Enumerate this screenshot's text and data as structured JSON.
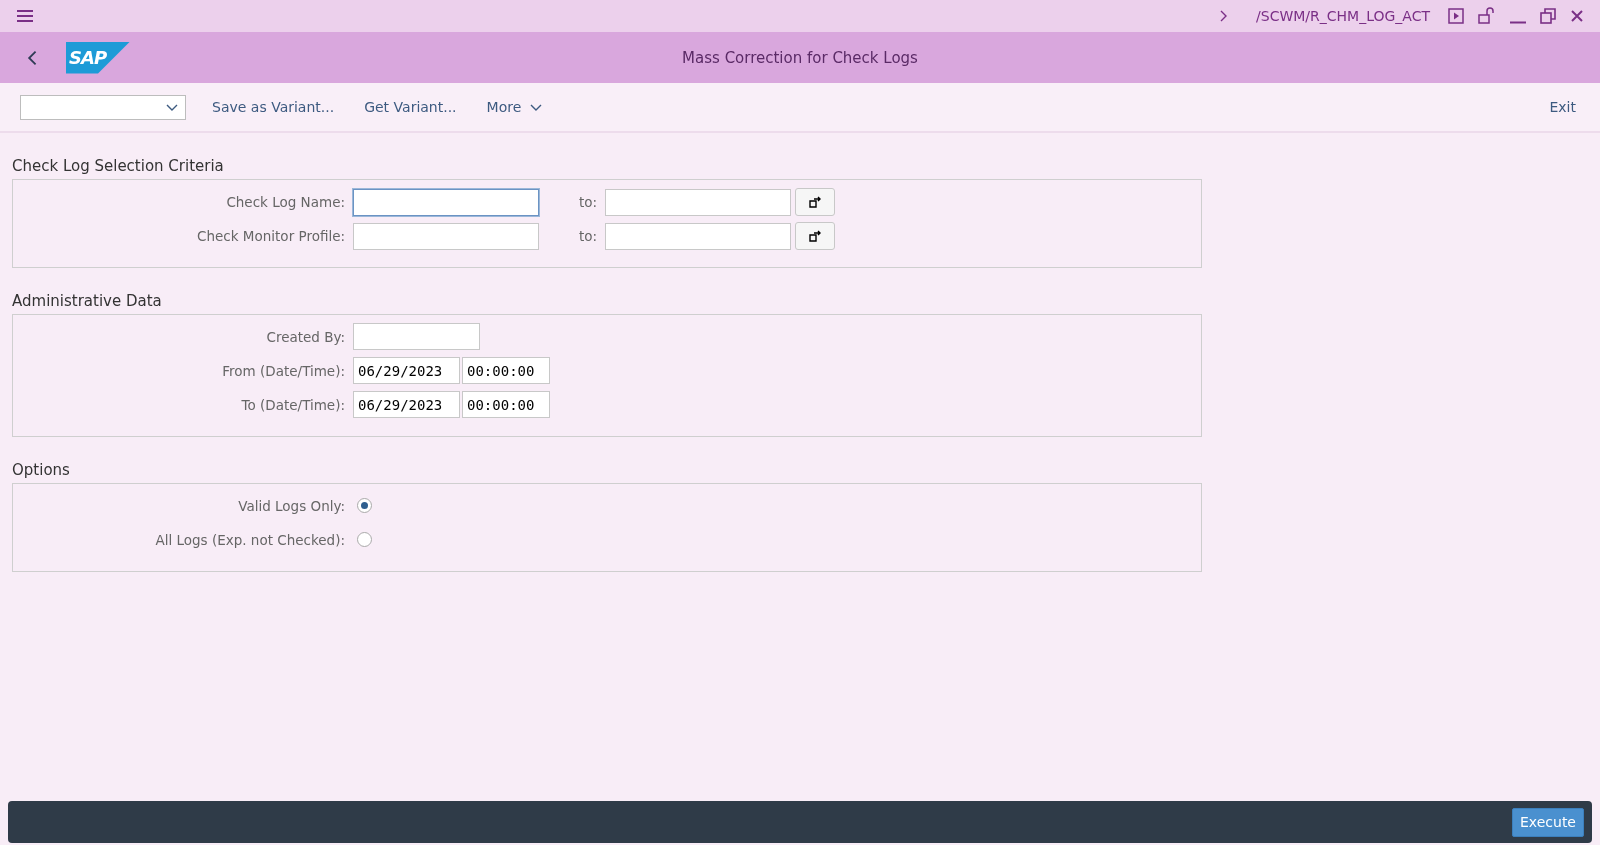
{
  "shell": {
    "transaction": "/SCWM/R_CHM_LOG_ACT"
  },
  "header": {
    "logo": "SAP",
    "title": "Mass Correction for Check Logs"
  },
  "toolbar": {
    "actions": [
      "Save as Variant...",
      "Get Variant..."
    ],
    "more": "More",
    "exit": "Exit"
  },
  "sections": [
    {
      "title": "Check Log Selection Criteria",
      "rows": [
        {
          "kind": "range",
          "label": "Check Log Name:",
          "focused": true,
          "to_label": "to:"
        },
        {
          "kind": "range",
          "label": "Check Monitor Profile:",
          "focused": false,
          "to_label": "to:"
        }
      ]
    },
    {
      "title": "Administrative Data",
      "rows": [
        {
          "kind": "single",
          "label": "Created By:",
          "focused": false
        },
        {
          "kind": "datetime",
          "label": "From (Date/Time):",
          "date": "06/29/2023",
          "time": "00:00:00"
        },
        {
          "kind": "datetime",
          "label": "To (Date/Time):",
          "date": "06/29/2023",
          "time": "00:00:00"
        }
      ]
    },
    {
      "title": "Options",
      "rows": [
        {
          "kind": "radio",
          "label": "Valid Logs Only:",
          "selected": true
        },
        {
          "kind": "radio",
          "label": "All Logs (Exp. not Checked):",
          "selected": false
        }
      ]
    }
  ],
  "footer": {
    "button": "Execute"
  }
}
